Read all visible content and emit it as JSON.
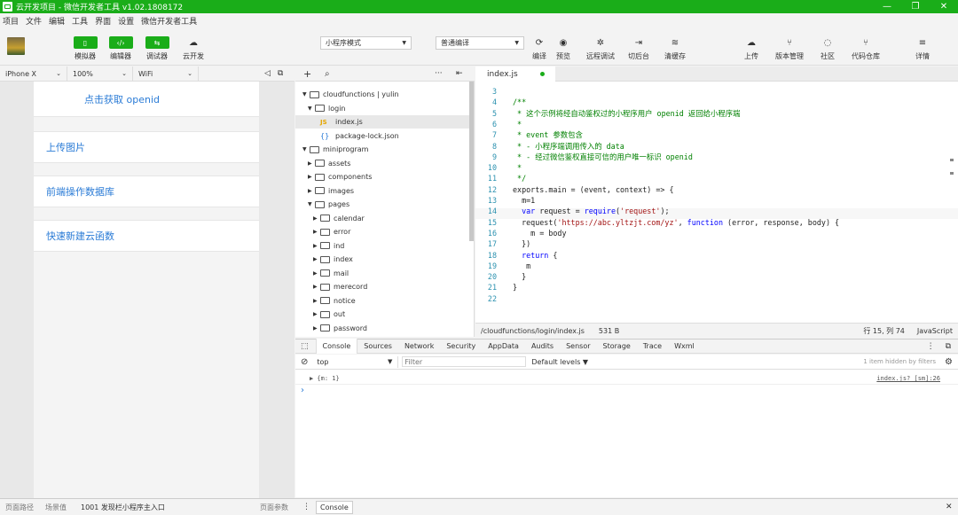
{
  "window": {
    "title": "云开发项目 - 微信开发者工具 v1.02.1808172",
    "controls": [
      "—",
      "❐",
      "✕"
    ]
  },
  "menu": [
    "项目",
    "文件",
    "编辑",
    "工具",
    "界面",
    "设置",
    "微信开发者工具"
  ],
  "toolbar": {
    "left_buttons": [
      {
        "label": "模拟器",
        "icon": "▯"
      },
      {
        "label": "编辑器",
        "icon": "‹/›"
      },
      {
        "label": "调试器",
        "icon": "⇆"
      },
      {
        "label": "云开发",
        "icon": "☁"
      }
    ],
    "mode_select": "小程序模式",
    "compile_select": "普通编译",
    "mid_buttons": [
      {
        "label": "编译",
        "icon": "⟳"
      },
      {
        "label": "预览",
        "icon": "◉"
      },
      {
        "label": "远程调试",
        "icon": "✲"
      },
      {
        "label": "切后台",
        "icon": "⇥"
      },
      {
        "label": "清缓存",
        "icon": "≋"
      }
    ],
    "right_buttons": [
      {
        "label": "上传",
        "icon": "☁"
      },
      {
        "label": "版本管理",
        "icon": "⑂"
      },
      {
        "label": "社区",
        "icon": "◌"
      },
      {
        "label": "代码仓库",
        "icon": "⑂"
      },
      {
        "label": "详情",
        "icon": "≡"
      }
    ]
  },
  "devicebar": {
    "device": "iPhone X",
    "zoom": "100%",
    "network": "WiFi"
  },
  "simulator": {
    "items": [
      "点击获取 openid",
      "上传图片",
      "前端操作数据库",
      "快速新建云函数"
    ]
  },
  "filetree": {
    "rows": [
      {
        "label": "cloudfunctions | yulin",
        "indent": 0,
        "arrow": "▼",
        "type": "cloud"
      },
      {
        "label": "login",
        "indent": 1,
        "arrow": "▼",
        "type": "cloud"
      },
      {
        "label": "index.js",
        "indent": 2,
        "arrow": "",
        "type": "js",
        "selected": true
      },
      {
        "label": "package-lock.json",
        "indent": 2,
        "arrow": "",
        "type": "json"
      },
      {
        "label": "miniprogram",
        "indent": 0,
        "arrow": "▼",
        "type": "folder"
      },
      {
        "label": "assets",
        "indent": 1,
        "arrow": "▶",
        "type": "folder"
      },
      {
        "label": "components",
        "indent": 1,
        "arrow": "▶",
        "type": "folder"
      },
      {
        "label": "images",
        "indent": 1,
        "arrow": "▶",
        "type": "folder"
      },
      {
        "label": "pages",
        "indent": 1,
        "arrow": "▼",
        "type": "folder"
      },
      {
        "label": "calendar",
        "indent": 2,
        "arrow": "▶",
        "type": "folder"
      },
      {
        "label": "error",
        "indent": 2,
        "arrow": "▶",
        "type": "folder"
      },
      {
        "label": "ind",
        "indent": 2,
        "arrow": "▶",
        "type": "folder"
      },
      {
        "label": "index",
        "indent": 2,
        "arrow": "▶",
        "type": "folder"
      },
      {
        "label": "mail",
        "indent": 2,
        "arrow": "▶",
        "type": "folder"
      },
      {
        "label": "merecord",
        "indent": 2,
        "arrow": "▶",
        "type": "folder"
      },
      {
        "label": "notice",
        "indent": 2,
        "arrow": "▶",
        "type": "folder"
      },
      {
        "label": "out",
        "indent": 2,
        "arrow": "▶",
        "type": "folder"
      },
      {
        "label": "password",
        "indent": 2,
        "arrow": "▶",
        "type": "folder"
      }
    ]
  },
  "editor": {
    "tab": "index.js",
    "lines": [
      {
        "n": "3",
        "t": [
          [
            "plain",
            ""
          ]
        ]
      },
      {
        "n": "4",
        "t": [
          [
            "cm",
            "/**"
          ]
        ]
      },
      {
        "n": "5",
        "t": [
          [
            "cm",
            " * 这个示例将经自动鉴权过的小程序用户 openid 返回给小程序端"
          ]
        ]
      },
      {
        "n": "6",
        "t": [
          [
            "cm",
            " *"
          ]
        ]
      },
      {
        "n": "7",
        "t": [
          [
            "cm",
            " * event 参数包含"
          ]
        ]
      },
      {
        "n": "8",
        "t": [
          [
            "cm",
            " * - 小程序端调用传入的 data"
          ]
        ]
      },
      {
        "n": "9",
        "t": [
          [
            "cm",
            " * - 经过微信鉴权直接可信的用户唯一标识 openid"
          ]
        ]
      },
      {
        "n": "10",
        "t": [
          [
            "cm",
            " *"
          ]
        ]
      },
      {
        "n": "11",
        "t": [
          [
            "cm",
            " */"
          ]
        ]
      },
      {
        "n": "12",
        "t": [
          [
            "plain",
            "exports.main = (event, context) => {"
          ]
        ]
      },
      {
        "n": "13",
        "t": [
          [
            "plain",
            "  m=1"
          ]
        ]
      },
      {
        "n": "14",
        "t": [
          [
            "plain",
            "  "
          ],
          [
            "kw",
            "var"
          ],
          [
            "plain",
            " request = "
          ],
          [
            "kw",
            "require"
          ],
          [
            "plain",
            "("
          ],
          [
            "str",
            "'request'"
          ],
          [
            "plain",
            ");"
          ]
        ]
      },
      {
        "n": "15",
        "t": [
          [
            "plain",
            "  request("
          ],
          [
            "str",
            "'https://abc.yltzjt.com/yz'"
          ],
          [
            "plain",
            ", "
          ],
          [
            "kw",
            "function"
          ],
          [
            "plain",
            " (error, response, body) {"
          ]
        ]
      },
      {
        "n": "16",
        "t": [
          [
            "plain",
            "    m = body"
          ]
        ]
      },
      {
        "n": "17",
        "t": [
          [
            "plain",
            "  })"
          ]
        ]
      },
      {
        "n": "18",
        "t": [
          [
            "plain",
            "  "
          ],
          [
            "kw",
            "return"
          ],
          [
            "plain",
            " {"
          ]
        ]
      },
      {
        "n": "19",
        "t": [
          [
            "plain",
            "   m"
          ]
        ]
      },
      {
        "n": "20",
        "t": [
          [
            "plain",
            "  }"
          ]
        ]
      },
      {
        "n": "21",
        "t": [
          [
            "plain",
            "}"
          ]
        ]
      },
      {
        "n": "22",
        "t": [
          [
            "plain",
            ""
          ]
        ]
      }
    ],
    "status": {
      "path": "/cloudfunctions/login/index.js",
      "size": "531 B",
      "cursor": "行 15, 列 74",
      "lang": "JavaScript"
    }
  },
  "devtools": {
    "tabs": [
      "Console",
      "Sources",
      "Network",
      "Security",
      "AppData",
      "Audits",
      "Sensor",
      "Storage",
      "Trace",
      "Wxml"
    ],
    "context": "top",
    "filter_placeholder": "Filter",
    "levels": "Default levels ▼",
    "hidden_info": "1 item hidden by filters",
    "log_text": "▶ {m: 1}",
    "log_source": "index.js? [sm]:26",
    "prompt": "›"
  },
  "bottombar": {
    "path_label": "页面路径",
    "scene_label": "场景值",
    "scene_value": "1001 发现栏小程序主入口",
    "params_label": "页面参数",
    "drawer_tab": "Console"
  }
}
